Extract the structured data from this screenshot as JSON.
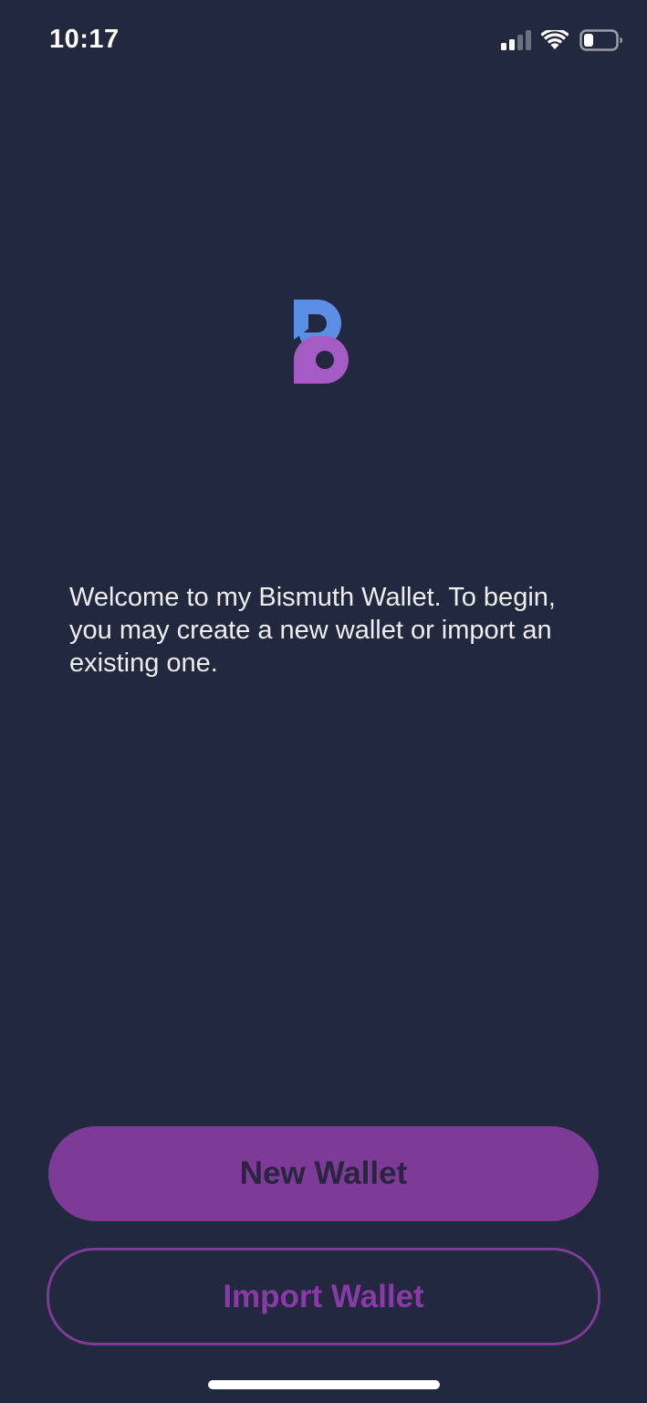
{
  "status_bar": {
    "time": "10:17",
    "signal_icon": "cellular-signal-icon",
    "wifi_icon": "wifi-icon",
    "battery_icon": "battery-icon",
    "battery_level": 0.3
  },
  "logo": {
    "icon": "bismuth-logo-icon",
    "colors": {
      "top": "#5b8fe6",
      "bottom": "#a55bc4"
    }
  },
  "welcome": {
    "text": "Welcome to my Bismuth Wallet. To begin, you may create a new wallet or import an existing one."
  },
  "actions": {
    "new_wallet_label": "New Wallet",
    "import_wallet_label": "Import Wallet"
  },
  "colors": {
    "background": "#22283d",
    "accent": "#7e3a97"
  }
}
